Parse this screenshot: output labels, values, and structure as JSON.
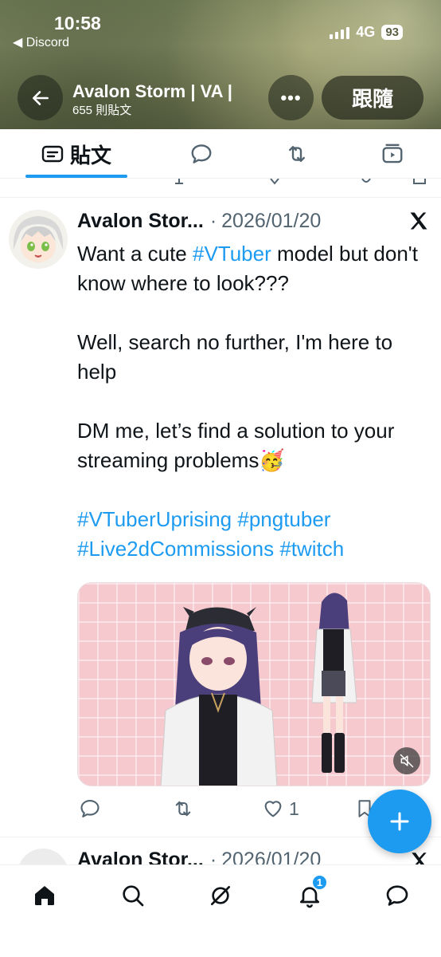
{
  "status_bar": {
    "time": "10:58",
    "back_app": "◀ Discord",
    "network": "4G",
    "battery": "93"
  },
  "header": {
    "profile_name": "Avalon Storm | VA |",
    "post_count": "655 則貼文",
    "follow_label": "跟隨",
    "more_label": "•••"
  },
  "tabs": [
    {
      "label": "貼文",
      "icon": "posts-icon",
      "active": true
    },
    {
      "label": "",
      "icon": "replies-icon"
    },
    {
      "label": "",
      "icon": "reposts-icon"
    },
    {
      "label": "",
      "icon": "media-icon"
    }
  ],
  "tweet": {
    "author": "Avalon Stor...",
    "separator": "·",
    "date": "2026/01/20",
    "source_icon": "x-logo-icon",
    "body": {
      "p1_prefix": "Want a cute ",
      "p1_tag": "#VTuber",
      "p1_suffix": " model but don't know where to look???",
      "p2": "Well, search no further, I'm here to help",
      "p3": "DM me, let’s find a solution to your streaming problems",
      "p3_emoji": "🥳",
      "tags": [
        "#VTuberUprising",
        "#pngtuber",
        "#Live2dCommissions",
        "#twitch"
      ]
    },
    "media": {
      "description": "vtuber-model-preview",
      "mute_icon": "muted-speaker-icon"
    },
    "actions": {
      "reply_count": "",
      "repost_count": "",
      "like_count": "1",
      "bookmark_count": ""
    }
  },
  "next_tweet": {
    "author": "Avalon Stor...",
    "separator": "·",
    "date": "2026/01/20"
  },
  "fab": {
    "icon": "plus-icon"
  },
  "bottom_nav": {
    "items": [
      "home-icon",
      "search-icon",
      "grok-icon",
      "notifications-icon",
      "messages-icon"
    ],
    "notification_badge": "1"
  },
  "colors": {
    "accent": "#1d9bf0",
    "text": "#0f1419",
    "muted": "#536471"
  }
}
